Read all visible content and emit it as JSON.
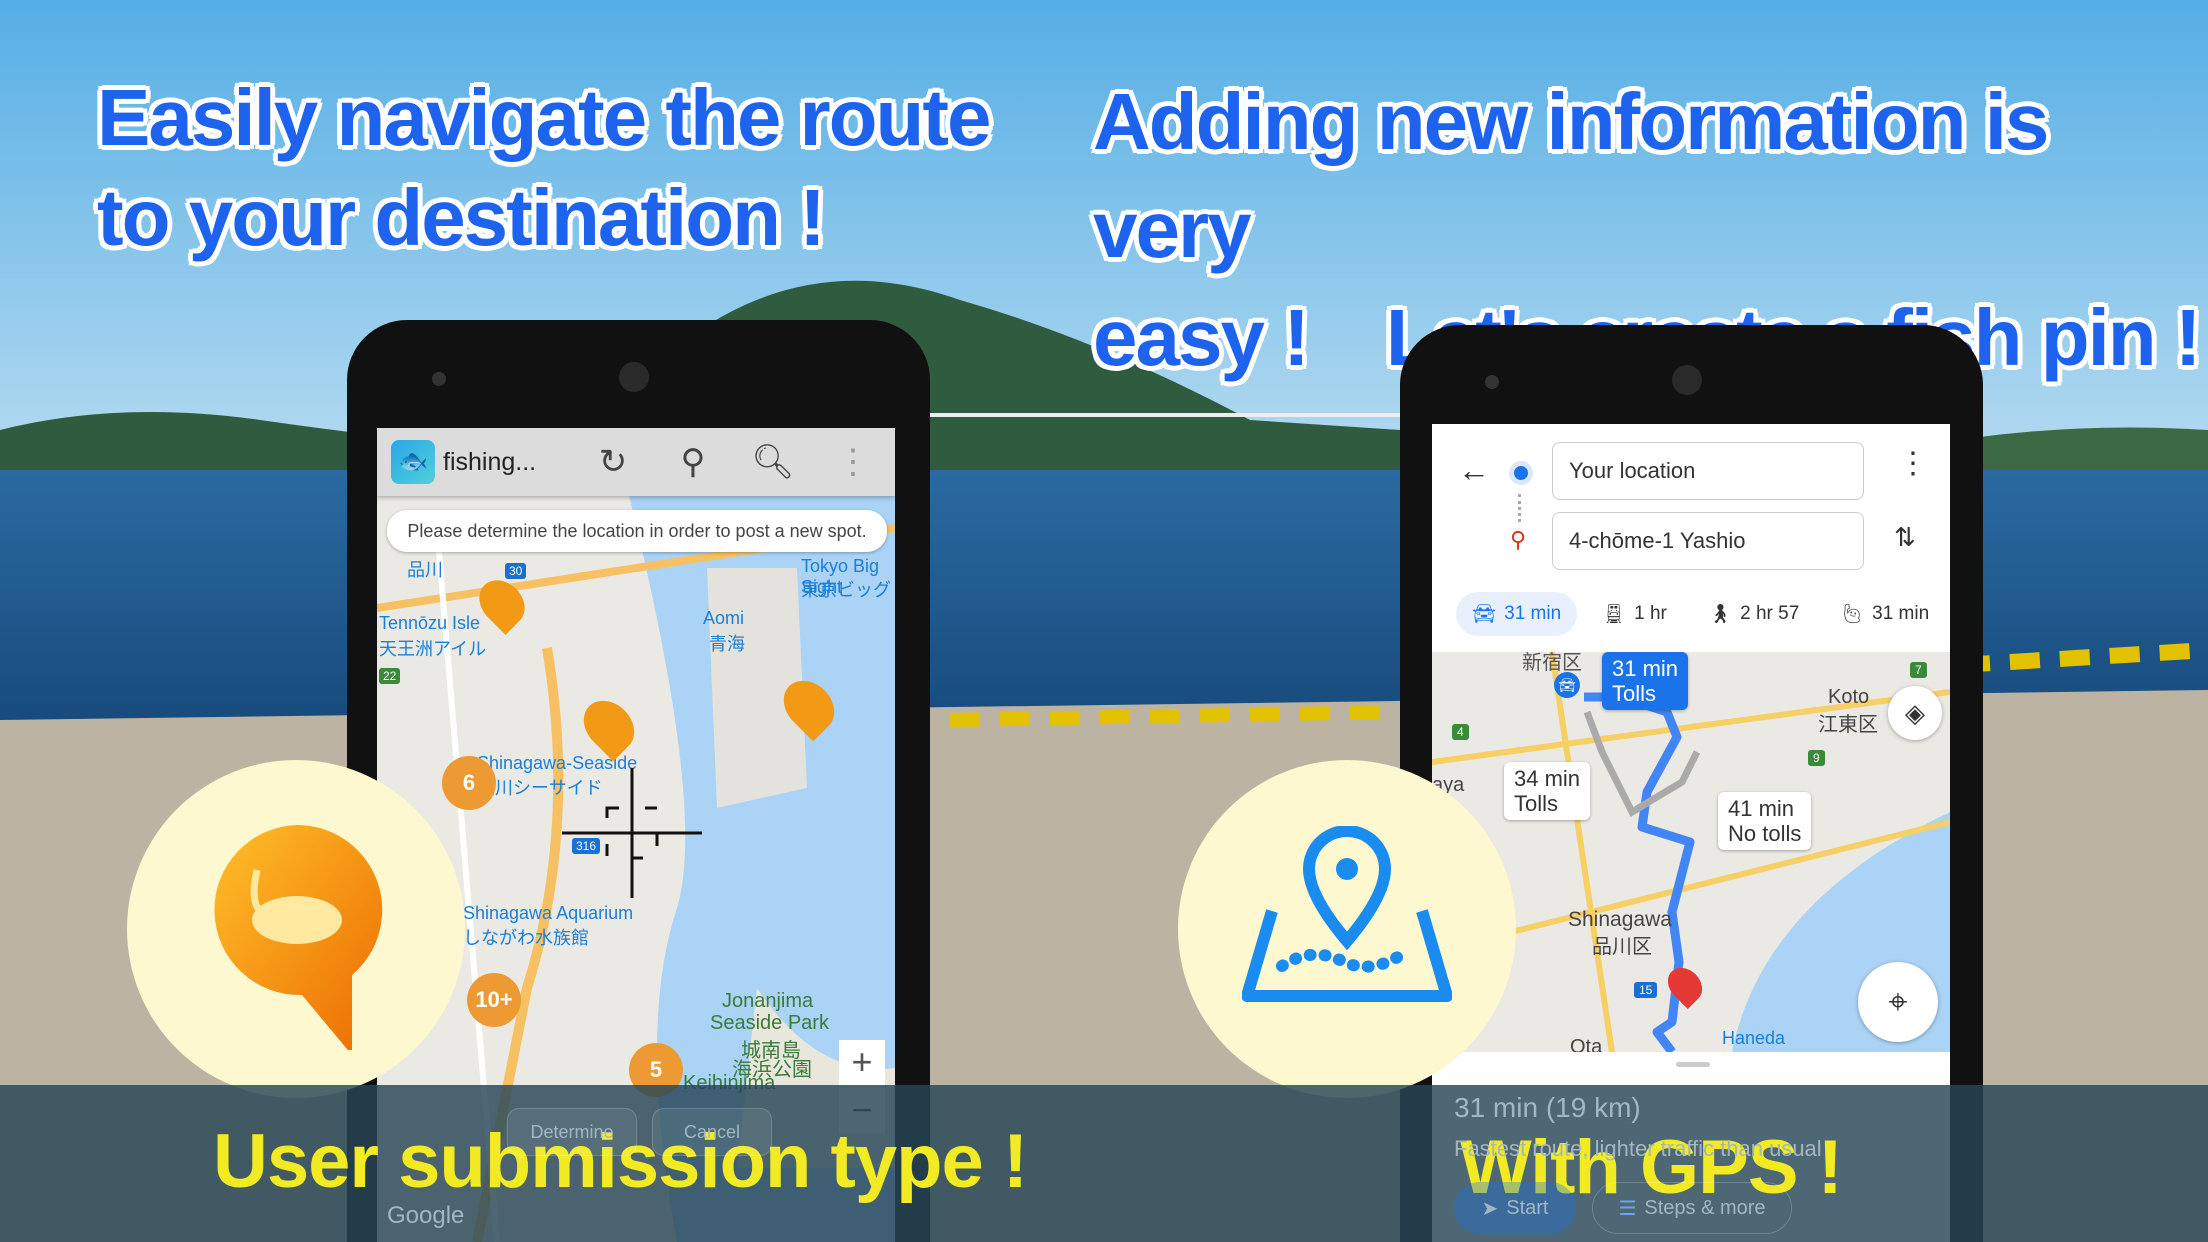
{
  "headlines": {
    "left_line1": "Easily navigate the route",
    "left_line2": "to your destination !",
    "right_line1": "Adding new information is very",
    "right_line2": "easy !　Let's create a fish pin !"
  },
  "captions": {
    "left": "User submission type !",
    "right": "With GPS !"
  },
  "left_phone": {
    "app_title": "fishing...",
    "toolbar_icons": [
      "refresh-icon",
      "location-pin-icon",
      "search-icon",
      "more-vert-icon"
    ],
    "toast": "Please determine the location in order to post a new spot.",
    "map_labels": [
      "品川",
      "Tennōzu Isle",
      "天王洲アイル",
      "Aomi",
      "青海",
      "Tokyo Big Sight",
      "東京ビッグ",
      "Shinagawa-Seaside",
      "品川シーサイド",
      "Shinagawa Aquarium",
      "しながわ水族館",
      "Jonanjima",
      "Seaside Park",
      "城南島",
      "海浜公園",
      "Keihinjima"
    ],
    "road_labels": [
      "316",
      "30",
      "22"
    ],
    "clusters": [
      "6",
      "10+",
      "5"
    ],
    "zoom_in": "+",
    "zoom_out": "−",
    "buttons": {
      "determine": "Determine",
      "cancel": "Cancel"
    },
    "map_attribution": "Google",
    "accent": "#ed9a35"
  },
  "right_phone": {
    "origin": "Your location",
    "destination": "4-chōme-1 Yashio",
    "modes": [
      {
        "icon": "car-icon",
        "label": "31 min",
        "selected": true
      },
      {
        "icon": "train-icon",
        "label": "1 hr"
      },
      {
        "icon": "walk-icon",
        "label": "2 hr 57"
      },
      {
        "icon": "ride-hail-icon",
        "label": "31 min"
      }
    ],
    "routes": [
      {
        "time": "31 min",
        "note": "Tolls",
        "selected": true
      },
      {
        "time": "34 min",
        "note": "Tolls"
      },
      {
        "time": "41 min",
        "note": "No tolls"
      }
    ],
    "map_labels": [
      "新宿区",
      "Koto",
      "江東区",
      "aya",
      "Shinagawa",
      "品川区",
      "Ota",
      "Haneda"
    ],
    "road_labels": [
      "4",
      "9",
      "7",
      "15"
    ],
    "summary": "31 min  (19 km)",
    "summary_sub": "Fastest route, lighter traffic than usual",
    "start_label": "Start",
    "steps_label": "Steps & more",
    "accent": "#1a73e8"
  }
}
